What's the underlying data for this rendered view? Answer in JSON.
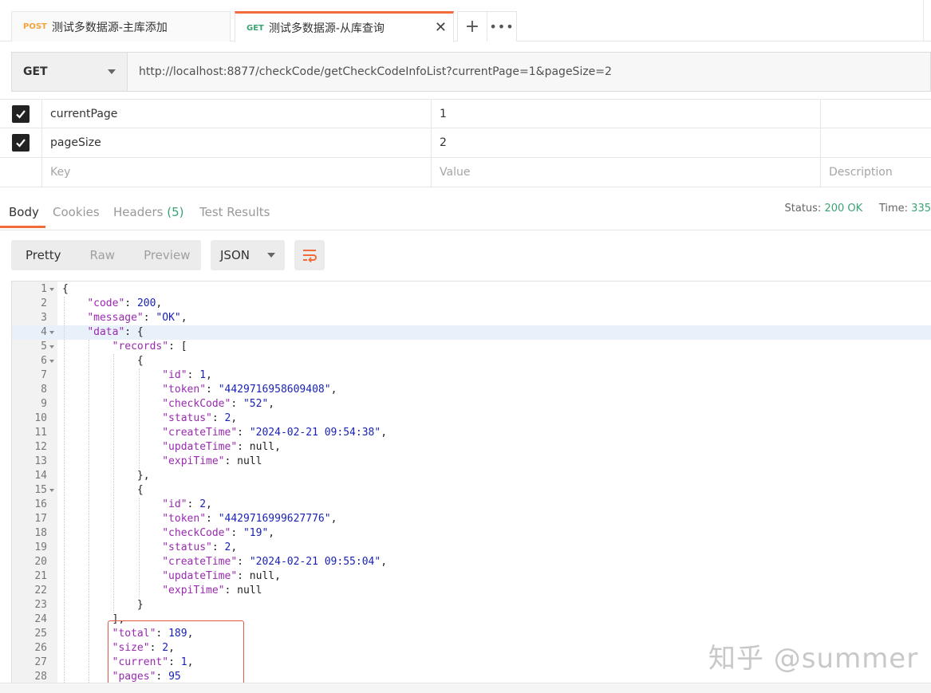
{
  "tabs": [
    {
      "method": "POST",
      "title": "测试多数据源-主库添加"
    },
    {
      "method": "GET",
      "title": "测试多数据源-从库查询"
    }
  ],
  "request": {
    "method": "GET",
    "url": "http://localhost:8877/checkCode/getCheckCodeInfoList?currentPage=1&pageSize=2"
  },
  "params": {
    "rows": [
      {
        "key": "currentPage",
        "value": "1"
      },
      {
        "key": "pageSize",
        "value": "2"
      }
    ],
    "placeholders": {
      "key": "Key",
      "value": "Value",
      "description": "Description"
    }
  },
  "response_tabs": {
    "body": "Body",
    "cookies": "Cookies",
    "headers": "Headers",
    "headers_count": "(5)",
    "tests": "Test Results"
  },
  "status": {
    "status_label": "Status:",
    "status_value": "200 OK",
    "time_label": "Time:",
    "time_value": "335"
  },
  "view": {
    "pretty": "Pretty",
    "raw": "Raw",
    "preview": "Preview",
    "format": "JSON"
  },
  "code_lines": [
    "{",
    "    \"code\": 200,",
    "    \"message\": \"OK\",",
    "    \"data\": {",
    "        \"records\": [",
    "            {",
    "                \"id\": 1,",
    "                \"token\": \"4429716958609408\",",
    "                \"checkCode\": \"52\",",
    "                \"status\": 2,",
    "                \"createTime\": \"2024-02-21 09:54:38\",",
    "                \"updateTime\": null,",
    "                \"expiTime\": null",
    "            },",
    "            {",
    "                \"id\": 2,",
    "                \"token\": \"4429716999627776\",",
    "                \"checkCode\": \"19\",",
    "                \"status\": 2,",
    "                \"createTime\": \"2024-02-21 09:55:04\",",
    "                \"updateTime\": null,",
    "                \"expiTime\": null",
    "            }",
    "        ],",
    "        \"total\": 189,",
    "        \"size\": 2,",
    "        \"current\": 1,",
    "        \"pages\": 95"
  ],
  "fold_lines": [
    1,
    4,
    5,
    6,
    15
  ],
  "highlight_line": 4,
  "watermark": "知乎 @summer",
  "colors": {
    "accent": "#f26b3a",
    "ok": "#3aa373",
    "key": "#9a2ab0",
    "string": "#1a22b4"
  }
}
